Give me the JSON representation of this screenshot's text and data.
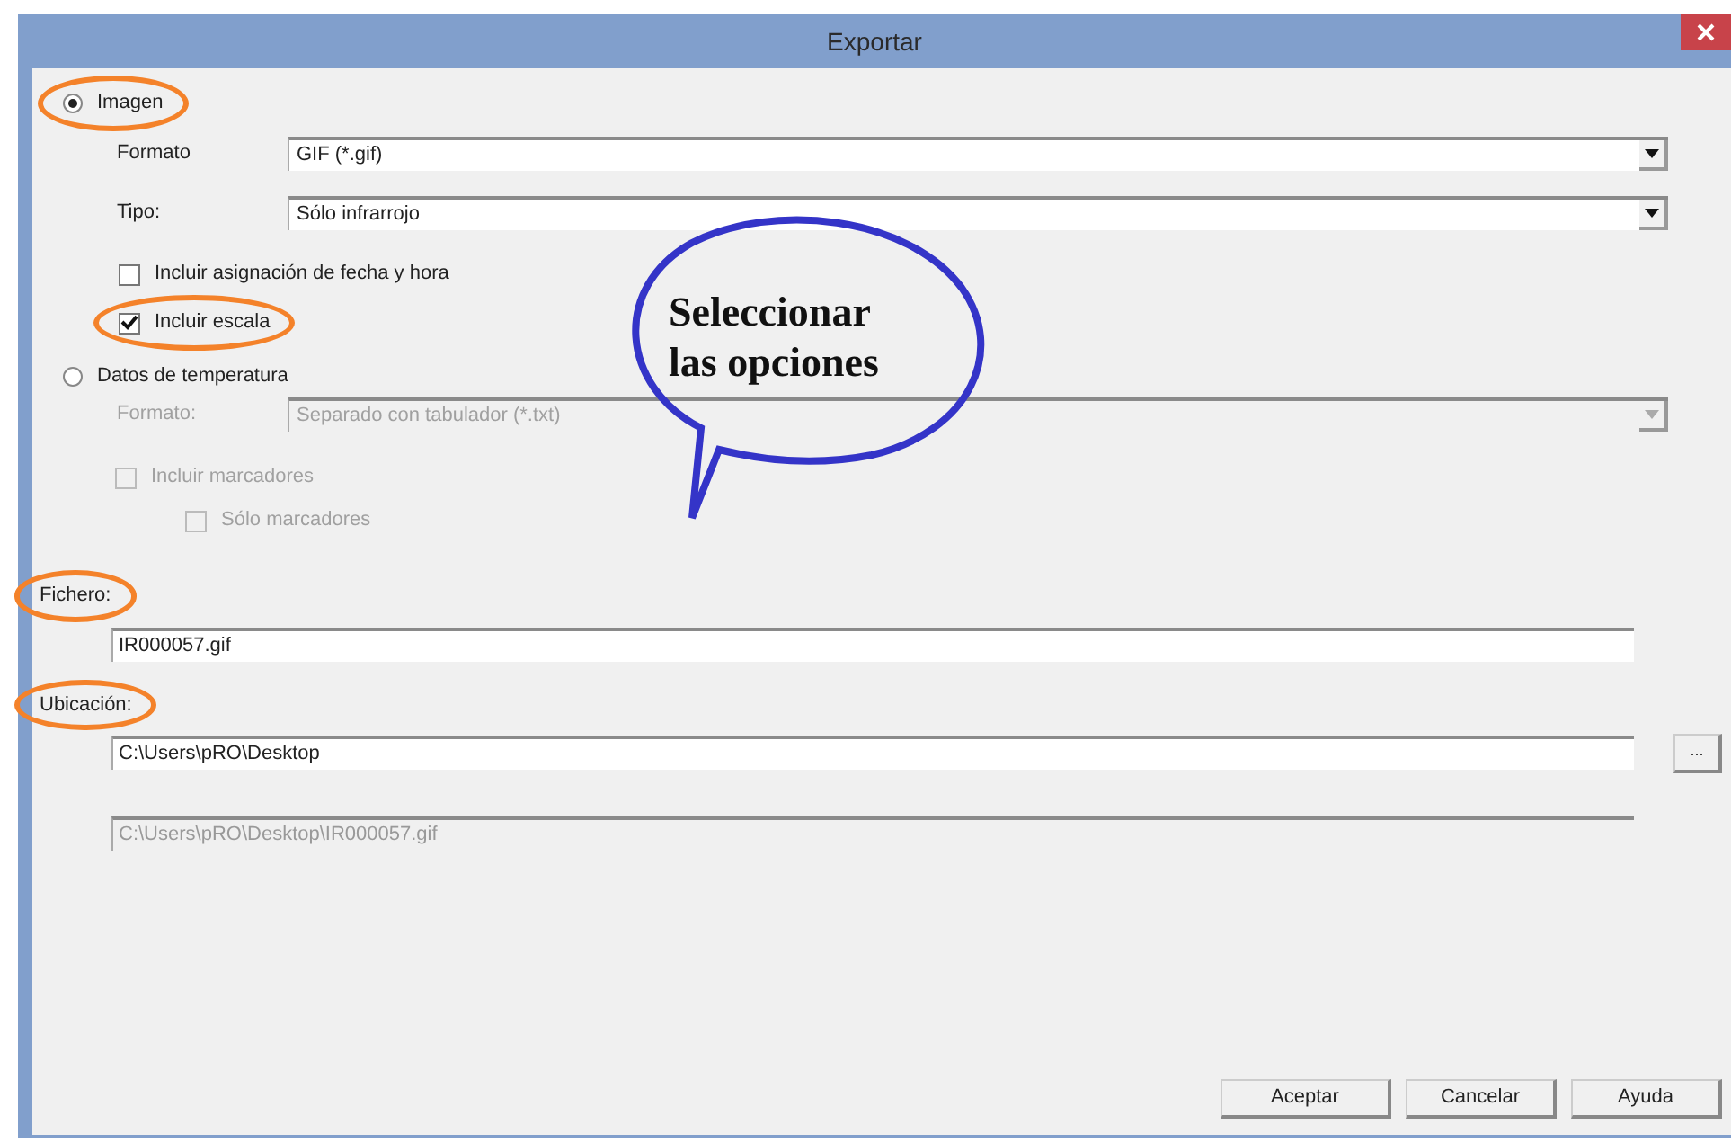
{
  "window": {
    "title": "Exportar"
  },
  "image": {
    "radio": {
      "label": "Imagen",
      "selected": true,
      "highlighted": true
    },
    "fields": [
      {
        "label": "Formato",
        "value": "GIF (*.gif)",
        "disabled": false
      },
      {
        "label": "Tipo:",
        "value": "Sólo infrarrojo",
        "disabled": false
      }
    ],
    "options": [
      {
        "label": "Incluir asignación de fecha y hora",
        "checked": false,
        "disabled": false,
        "highlighted": false
      },
      {
        "label": "Incluir escala",
        "checked": true,
        "disabled": false,
        "highlighted": true
      }
    ]
  },
  "temperature": {
    "radio": {
      "label": "Datos de temperatura",
      "selected": false,
      "highlighted": false
    },
    "fields": [
      {
        "label": "Formato:",
        "value": "Separado con tabulador (*.txt)",
        "disabled": true
      }
    ],
    "options": [
      {
        "label": "Incluir marcadores",
        "checked": false,
        "disabled": true,
        "children": [
          {
            "label": "Sólo marcadores",
            "checked": false,
            "disabled": true
          }
        ]
      }
    ]
  },
  "file": {
    "label": "Fichero:",
    "value": "IR000057.gif",
    "highlighted": true
  },
  "location": {
    "label": "Ubicación:",
    "value": "C:\\Users\\pRO\\Desktop",
    "browse": "...",
    "highlighted": true
  },
  "full_path": {
    "value": "C:\\Users\\pRO\\Desktop\\IR000057.gif",
    "disabled": true
  },
  "buttons": [
    "Aceptar",
    "Cancelar",
    "Ayuda"
  ],
  "annotation": {
    "text": "Seleccionar las opciones"
  }
}
